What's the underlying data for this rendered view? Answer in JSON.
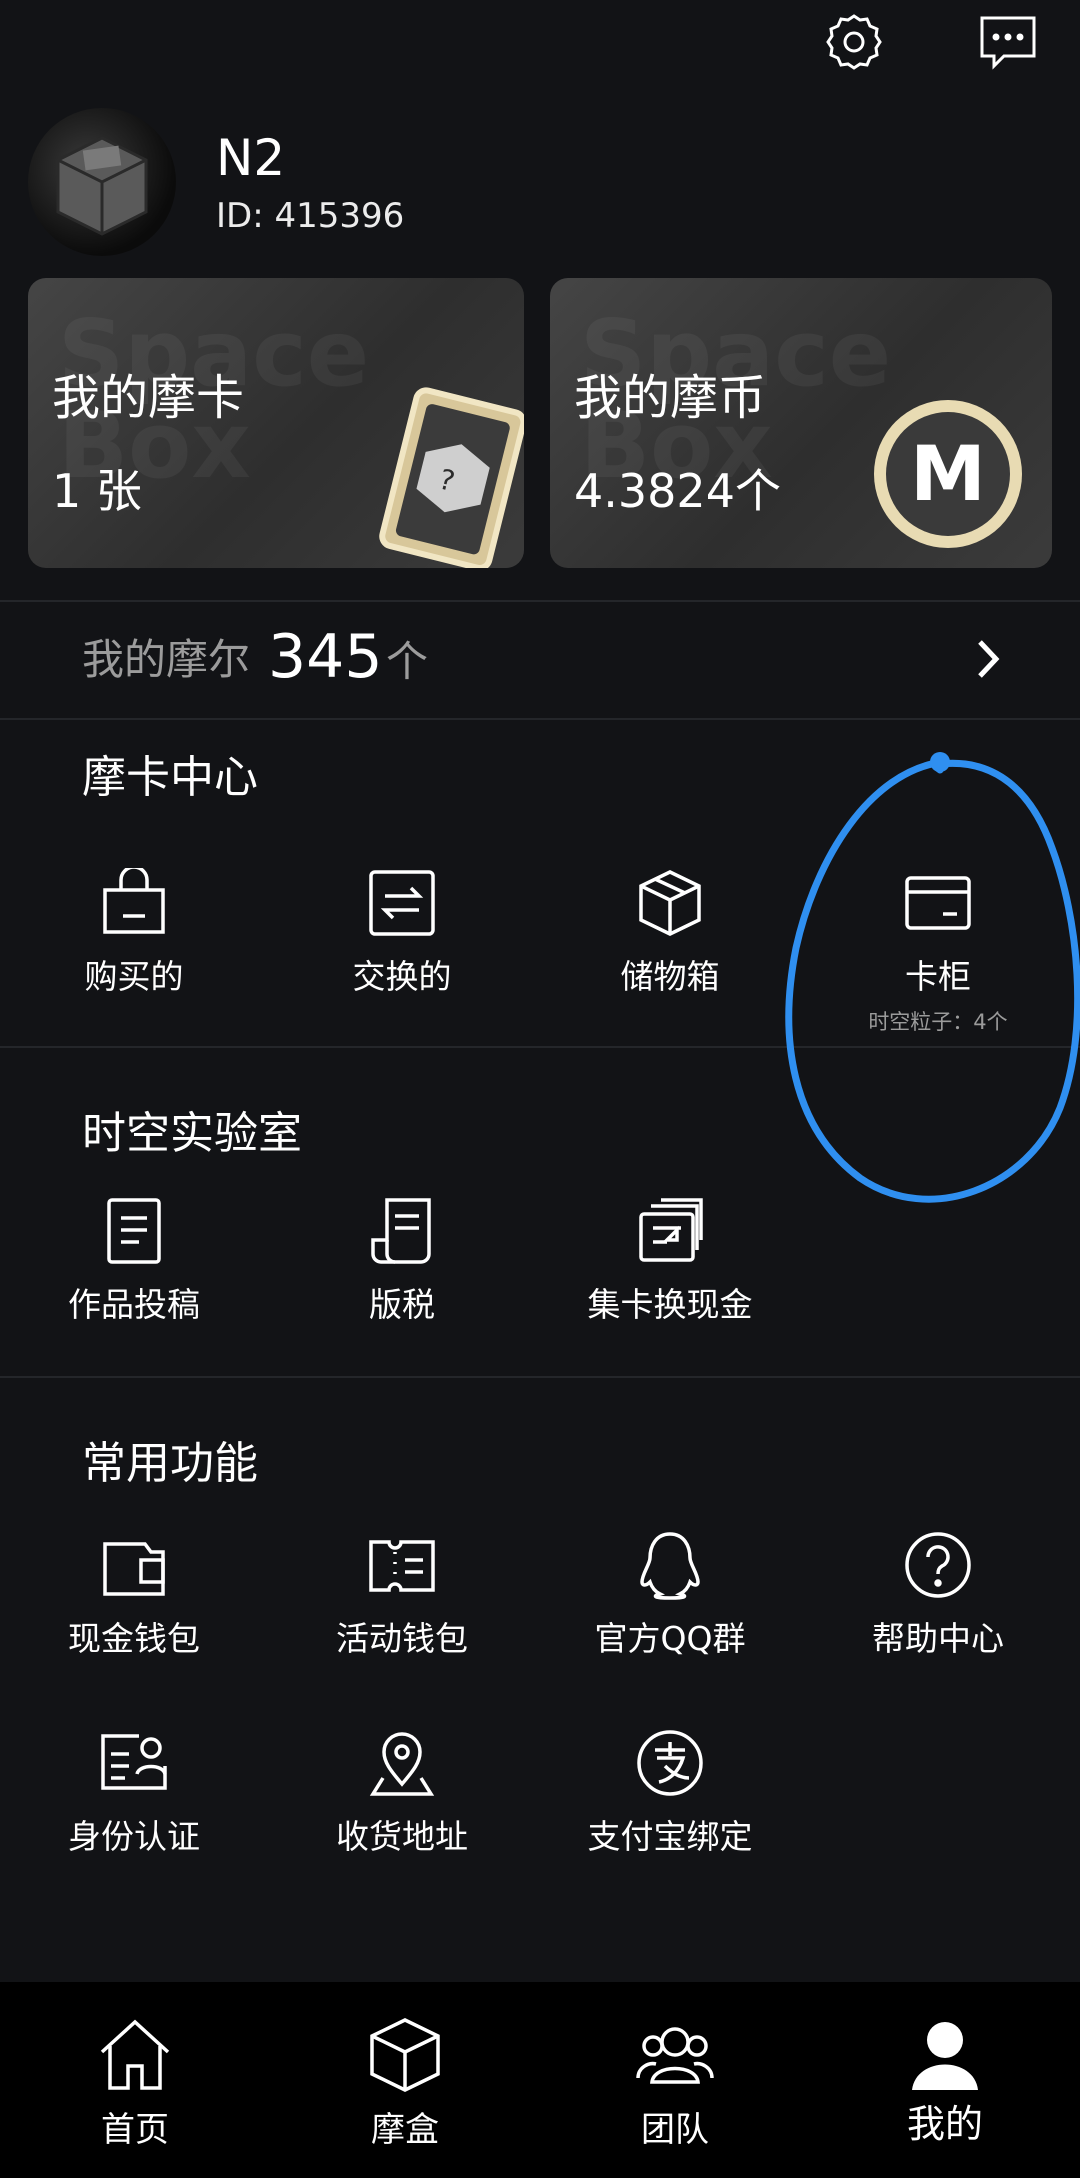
{
  "header": {
    "settings_icon": "gear-icon",
    "message_icon": "message-icon"
  },
  "profile": {
    "name": "N2",
    "id_text": "ID: 415396",
    "avatar_icon": "box-avatar"
  },
  "cards": [
    {
      "watermark": "Space Box",
      "title": "我的摩卡",
      "value": "1 张",
      "art": "card-art"
    },
    {
      "watermark": "Space Box",
      "title": "我的摩币",
      "value": "4.3824个",
      "art": "coin-M"
    }
  ],
  "moer": {
    "label": "我的摩尔",
    "value": "345",
    "unit": "个"
  },
  "moka_center": {
    "title": "摩卡中心",
    "items": [
      {
        "label": "购买的",
        "icon": "shopping-bag-icon"
      },
      {
        "label": "交换的",
        "icon": "exchange-icon"
      },
      {
        "label": "储物箱",
        "icon": "box-icon"
      },
      {
        "label": "卡柜",
        "icon": "card-icon",
        "sub": "时空粒子：4个"
      }
    ]
  },
  "lab": {
    "title": "时空实验室",
    "items": [
      {
        "label": "作品投稿",
        "icon": "document-icon"
      },
      {
        "label": "版税",
        "icon": "receipt-icon"
      },
      {
        "label": "集卡换现金",
        "icon": "cards-cash-icon"
      }
    ]
  },
  "common": {
    "title": "常用功能",
    "items": [
      {
        "label": "现金钱包",
        "icon": "wallet-icon"
      },
      {
        "label": "活动钱包",
        "icon": "ticket-icon"
      },
      {
        "label": "官方QQ群",
        "icon": "qq-icon"
      },
      {
        "label": "帮助中心",
        "icon": "help-icon"
      },
      {
        "label": "身份认证",
        "icon": "id-card-icon"
      },
      {
        "label": "收货地址",
        "icon": "location-icon"
      },
      {
        "label": "支付宝绑定",
        "icon": "alipay-icon"
      }
    ]
  },
  "nav": [
    {
      "label": "首页",
      "icon": "home-icon"
    },
    {
      "label": "摩盒",
      "icon": "cube-icon"
    },
    {
      "label": "团队",
      "icon": "team-icon"
    },
    {
      "label": "我的",
      "icon": "user-icon",
      "active": true
    }
  ],
  "colors": {
    "background": "#121316",
    "nav_background": "#000000",
    "annotation": "#2f8ff0"
  }
}
